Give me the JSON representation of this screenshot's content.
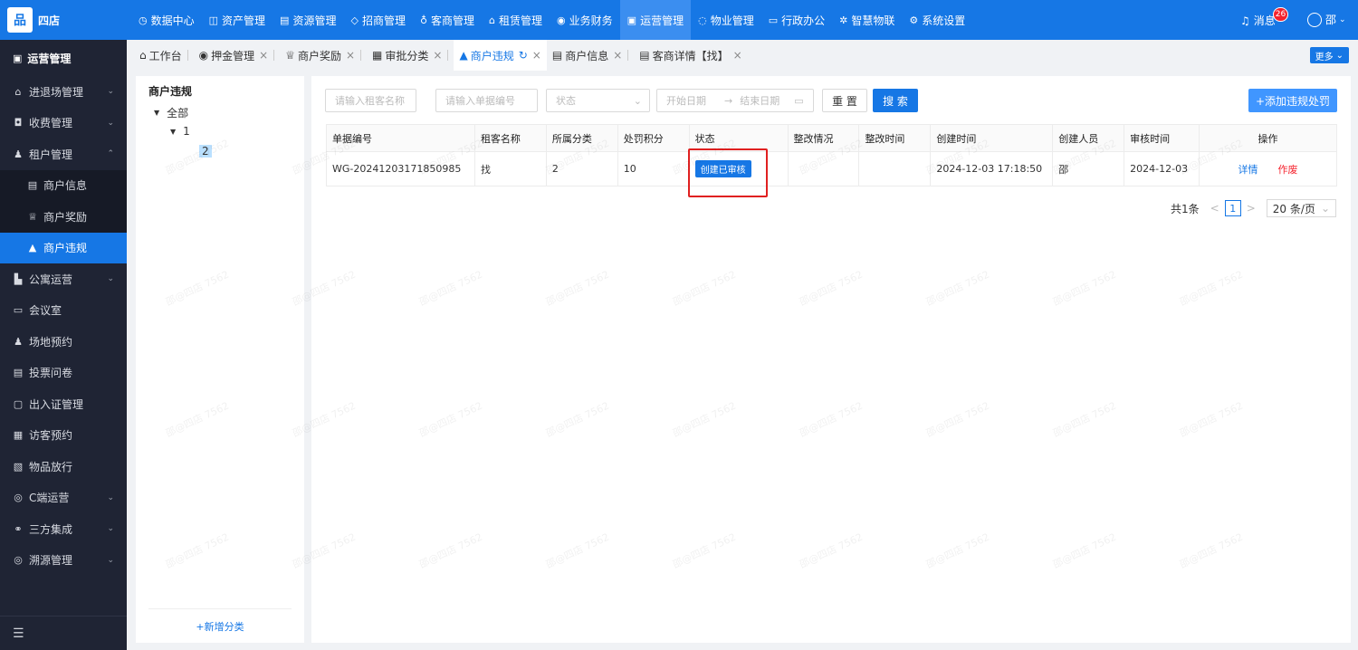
{
  "brand": {
    "logo_glyph": "品",
    "name": "四店"
  },
  "topnav": [
    {
      "icon": "◷",
      "label": "数据中心"
    },
    {
      "icon": "◫",
      "label": "资产管理"
    },
    {
      "icon": "▤",
      "label": "资源管理"
    },
    {
      "icon": "◇",
      "label": "招商管理"
    },
    {
      "icon": "♁",
      "label": "客商管理"
    },
    {
      "icon": "⌂",
      "label": "租赁管理"
    },
    {
      "icon": "◉",
      "label": "业务财务"
    },
    {
      "icon": "▣",
      "label": "运营管理"
    },
    {
      "icon": "◌",
      "label": "物业管理"
    },
    {
      "icon": "▭",
      "label": "行政办公"
    },
    {
      "icon": "✲",
      "label": "智慧物联"
    },
    {
      "icon": "⚙",
      "label": "系统设置"
    }
  ],
  "header": {
    "message_label": "消息",
    "message_count": "26",
    "user_name": "邵",
    "more_label": "更多"
  },
  "sidebar": {
    "title": "运营管理",
    "items": [
      {
        "icon": "⌂",
        "label": "进退场管理",
        "arrow": "⌄"
      },
      {
        "icon": "◘",
        "label": "收费管理",
        "arrow": "⌄"
      },
      {
        "icon": "♟",
        "label": "租户管理",
        "arrow": "⌃"
      },
      {
        "icon": "▤",
        "label": "商户信息",
        "sub": true
      },
      {
        "icon": "♕",
        "label": "商户奖励",
        "sub": true
      },
      {
        "icon": "▲",
        "label": "商户违规",
        "sub": true,
        "selected": true
      },
      {
        "icon": "▙",
        "label": "公寓运营",
        "arrow": "⌄"
      },
      {
        "icon": "▭",
        "label": "会议室"
      },
      {
        "icon": "♟",
        "label": "场地预约"
      },
      {
        "icon": "▤",
        "label": "投票问卷"
      },
      {
        "icon": "▢",
        "label": "出入证管理"
      },
      {
        "icon": "▦",
        "label": "访客预约"
      },
      {
        "icon": "▧",
        "label": "物品放行"
      },
      {
        "icon": "◎",
        "label": "C端运营",
        "arrow": "⌄"
      },
      {
        "icon": "⚭",
        "label": "三方集成",
        "arrow": "⌄"
      },
      {
        "icon": "◎",
        "label": "溯源管理",
        "arrow": "⌄"
      }
    ],
    "collapse_icon": "☰"
  },
  "tabs": [
    {
      "icon": "⌂",
      "label": "工作台",
      "closable": false
    },
    {
      "icon": "◉",
      "label": "押金管理",
      "closable": true
    },
    {
      "icon": "♕",
      "label": "商户奖励",
      "closable": true
    },
    {
      "icon": "▦",
      "label": "审批分类",
      "closable": true
    },
    {
      "icon": "▲",
      "label": "商户违规",
      "closable": true,
      "active": true
    },
    {
      "icon": "▤",
      "label": "商户信息",
      "closable": true
    },
    {
      "icon": "▤",
      "label": "客商详情【找】",
      "closable": true
    }
  ],
  "tree": {
    "title": "商户违规",
    "root": "全部",
    "child": "1",
    "leaf": "2",
    "add_label": "+新增分类"
  },
  "filters": {
    "tenant_placeholder": "请输入租客名称",
    "doc_placeholder": "请输入单据编号",
    "status_placeholder": "状态",
    "start_date": "开始日期",
    "end_date": "结束日期",
    "reset_label": "重 置",
    "search_label": "搜 索",
    "add_label": "+添加违规处罚"
  },
  "table": {
    "headers": [
      "单据编号",
      "租客名称",
      "所属分类",
      "处罚积分",
      "状态",
      "整改情况",
      "整改时间",
      "创建时间",
      "创建人员",
      "审核时间",
      "操作"
    ],
    "rows": [
      {
        "doc_no": "WG-20241203171850985",
        "tenant": "找",
        "category": "2",
        "points": "10",
        "status": "创建已审核",
        "fix_status": "",
        "fix_time": "",
        "created_at": "2024-12-03 17:18:50",
        "creator": "邵",
        "audit_time": "2024-12-03",
        "action_detail": "详情",
        "action_void": "作废"
      }
    ]
  },
  "pager": {
    "total": "共1条",
    "current": "1",
    "page_size": "20 条/页"
  },
  "watermark": "邵@四店 7562"
}
